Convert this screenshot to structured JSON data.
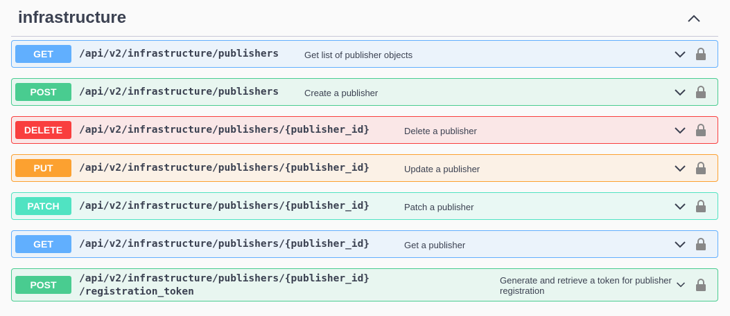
{
  "section": {
    "title": "infrastructure",
    "collapse_icon": "chevron-up-icon"
  },
  "operations": [
    {
      "method": "GET",
      "path": "/api/v2/infrastructure/publishers",
      "summary": "Get list of publisher objects"
    },
    {
      "method": "POST",
      "path": "/api/v2/infrastructure/publishers",
      "summary": "Create a publisher"
    },
    {
      "method": "DELETE",
      "path": "/api/v2/infrastructure/publishers/{publisher_id}",
      "summary": "Delete a publisher"
    },
    {
      "method": "PUT",
      "path": "/api/v2/infrastructure/publishers/{publisher_id}",
      "summary": "Update a publisher"
    },
    {
      "method": "PATCH",
      "path": "/api/v2/infrastructure/publishers/{publisher_id}",
      "summary": "Patch a publisher"
    },
    {
      "method": "GET",
      "path": "/api/v2/infrastructure/publishers/{publisher_id}",
      "summary": "Get a publisher"
    },
    {
      "method": "POST",
      "path_line1": "/api/v2/infrastructure/publishers/{publisher_id}",
      "path_line2": "/registration_token",
      "summary_line1": "Generate and retrieve a token for publisher",
      "summary_line2": "registration"
    }
  ],
  "icons": {
    "expand": "chevron-down-icon",
    "auth": "lock-icon"
  },
  "colors": {
    "get": "#61affe",
    "post": "#49cc90",
    "delete": "#f93e3e",
    "put": "#fca130",
    "patch": "#50e3c2",
    "text": "#3b4151"
  }
}
